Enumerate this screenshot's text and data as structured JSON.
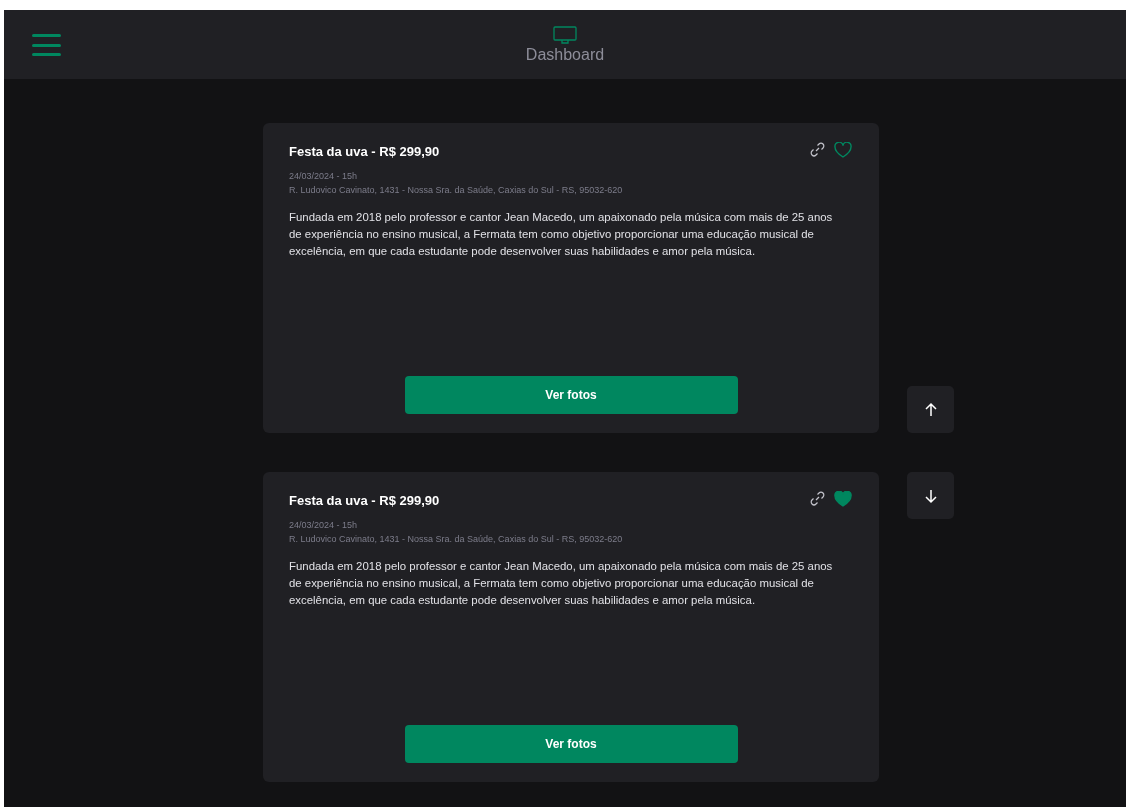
{
  "header": {
    "title": "Dashboard"
  },
  "events": [
    {
      "title": "Festa da uva - R$ 299,90",
      "date": "24/03/2024 - 15h",
      "address": "R. Ludovico Cavinato, 1431 - Nossa Sra. da Saúde, Caxias do Sul - RS, 95032-620",
      "description": "Fundada em 2018 pelo professor e cantor Jean Macedo, um apaixonado pela música com mais de 25 anos de experiência no ensino musical, a Fermata tem como objetivo proporcionar uma educação musical de excelência, em que cada estudante pode desenvolver suas habilidades e amor pela música.",
      "favorite": false,
      "button": "Ver fotos",
      "kind": "up"
    },
    {
      "title": "Festa da uva - R$ 299,90",
      "date": "24/03/2024 - 15h",
      "address": "R. Ludovico Cavinato, 1431 - Nossa Sra. da Saúde, Caxias do Sul - RS, 95032-620",
      "description": "Fundada em 2018 pelo professor e cantor Jean Macedo, um apaixonado pela música com mais de 25 anos de experiência no ensino musical, a Fermata tem como objetivo proporcionar uma educação musical de excelência, em que cada estudante pode desenvolver suas habilidades e amor pela música.",
      "favorite": true,
      "button": "Ver fotos",
      "kind": "down"
    }
  ]
}
